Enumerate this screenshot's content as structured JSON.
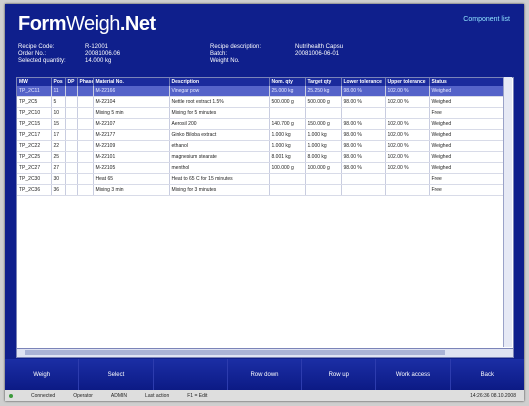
{
  "app": {
    "logo_bold": "Form",
    "logo_thin": "Weigh",
    "logo_suffix": ".Net",
    "component_list": "Component list"
  },
  "recipe": {
    "labels": [
      "Recipe Code:",
      "Order No.:",
      "Selected quantity:"
    ],
    "values": [
      "R-12001",
      "20081006.06",
      "14.000 kg"
    ],
    "labels2": [
      "Recipe description:",
      "Batch:",
      "Weight No."
    ],
    "values2": [
      "Nutrihealth Capsu",
      "20081006-06-01",
      ""
    ]
  },
  "table": {
    "columns": [
      "MW",
      "Pos",
      "DP",
      "Phase",
      "Material No.",
      "Description",
      "Nom. qty",
      "Target qty",
      "Lower tolerance",
      "Upper tolerance",
      "Status"
    ],
    "rows": [
      [
        "TP_2C11",
        "11",
        "",
        "",
        "M-22166",
        "Vinegar pow",
        "25.000 kg",
        "25.250 kg",
        "98.00 %",
        "102.00 %",
        "Weighed"
      ],
      [
        "TP_2C5",
        "5",
        "",
        "",
        "M-22104",
        "Nettle root extract 1.5%",
        "500.000 g",
        "500.000 g",
        "98.00 %",
        "102.00 %",
        "Weighed"
      ],
      [
        "TP_2C10",
        "10",
        "",
        "",
        "Mixing 5 min",
        "Mixing for 5 minutes",
        "",
        "",
        "",
        "",
        "Free"
      ],
      [
        "TP_2C15",
        "15",
        "",
        "",
        "M-22107",
        "Aerosil 200",
        "140.700 g",
        "150.000 g",
        "98.00 %",
        "102.00 %",
        "Weighed"
      ],
      [
        "TP_2C17",
        "17",
        "",
        "",
        "M-22177",
        "Ginko Biloba extract",
        "1.000 kg",
        "1.000 kg",
        "98.00 %",
        "102.00 %",
        "Weighed"
      ],
      [
        "TP_2C22",
        "22",
        "",
        "",
        "M-22109",
        "ethanol",
        "1.000 kg",
        "1.000 kg",
        "98.00 %",
        "102.00 %",
        "Weighed"
      ],
      [
        "TP_2C25",
        "25",
        "",
        "",
        "M-22101",
        "magnesium stearate",
        "8.001 kg",
        "8.000 kg",
        "98.00 %",
        "102.00 %",
        "Weighed"
      ],
      [
        "TP_2C27",
        "27",
        "",
        "",
        "M-22105",
        "menthol",
        "100.000 g",
        "100.000 g",
        "98.00 %",
        "102.00 %",
        "Weighed"
      ],
      [
        "TP_2C30",
        "30",
        "",
        "",
        "Heat 65",
        "Heat to 65 C for 15 minutes",
        "",
        "",
        "",
        "",
        "Free"
      ],
      [
        "TP_2C36",
        "36",
        "",
        "",
        "Mixing 3 min",
        "Mixing for 3 minutes",
        "",
        "",
        "",
        "",
        "Free"
      ]
    ]
  },
  "buttons": [
    "Weigh",
    "Select",
    "",
    "Row down",
    "Row up",
    "Work access",
    "Back"
  ],
  "status": {
    "item1": "Connected",
    "item2": "Operator",
    "item3": "ADMIN",
    "item4": "Last action",
    "item5": "F1 = Edit",
    "item6": "14:26:36  08.10.2008"
  }
}
